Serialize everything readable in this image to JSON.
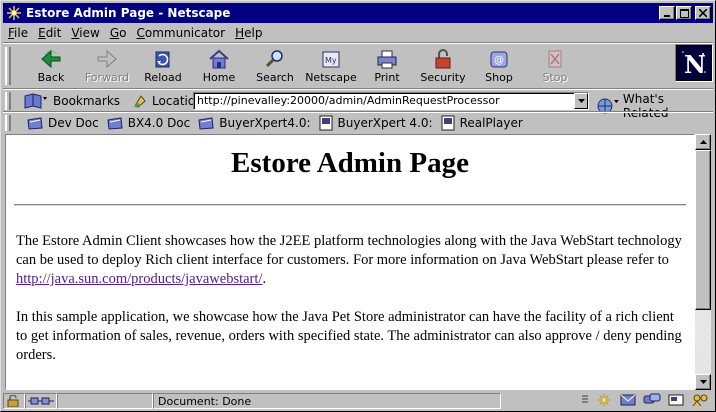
{
  "window": {
    "title": "Estore Admin Page - Netscape",
    "icon": "netscape-app-icon"
  },
  "menu": [
    {
      "accel": "F",
      "rest": "ile"
    },
    {
      "accel": "E",
      "rest": "dit"
    },
    {
      "accel": "V",
      "rest": "iew"
    },
    {
      "accel": "G",
      "rest": "o"
    },
    {
      "accel": "C",
      "rest": "ommunicator"
    },
    {
      "accel": "H",
      "rest": "elp"
    }
  ],
  "nav": {
    "back": "Back",
    "forward": "Forward",
    "reload": "Reload",
    "home": "Home",
    "search": "Search",
    "netscape": "Netscape",
    "print": "Print",
    "security": "Security",
    "shop": "Shop",
    "stop": "Stop"
  },
  "location": {
    "bookmarks_label": "Bookmarks",
    "location_label": "Location:",
    "url": "http://pinevalley:20000/admin/AdminRequestProcessor",
    "whats_related": "What's Related"
  },
  "personal_toolbar": [
    "Dev Doc",
    "BX4.0 Doc",
    "BuyerXpert4.0:",
    "BuyerXpert 4.0:",
    "RealPlayer"
  ],
  "page": {
    "heading": "Estore Admin Page",
    "para1_text": "The Estore Admin Client showcases how the J2EE platform technologies along with the Java WebStart technology can be used to deploy Rich client interface for customers. For more information on Java WebStart please refer to ",
    "para1_link": "http://java.sun.com/products/javawebstart/",
    "para1_end": ".",
    "para2": "In this sample application, we showcase how the Java Pet Store administrator can have the facility of a rich client to get information of sales, revenue, orders with specified state. The administrator can also approve / deny pending orders."
  },
  "status": {
    "text": "Document: Done"
  }
}
